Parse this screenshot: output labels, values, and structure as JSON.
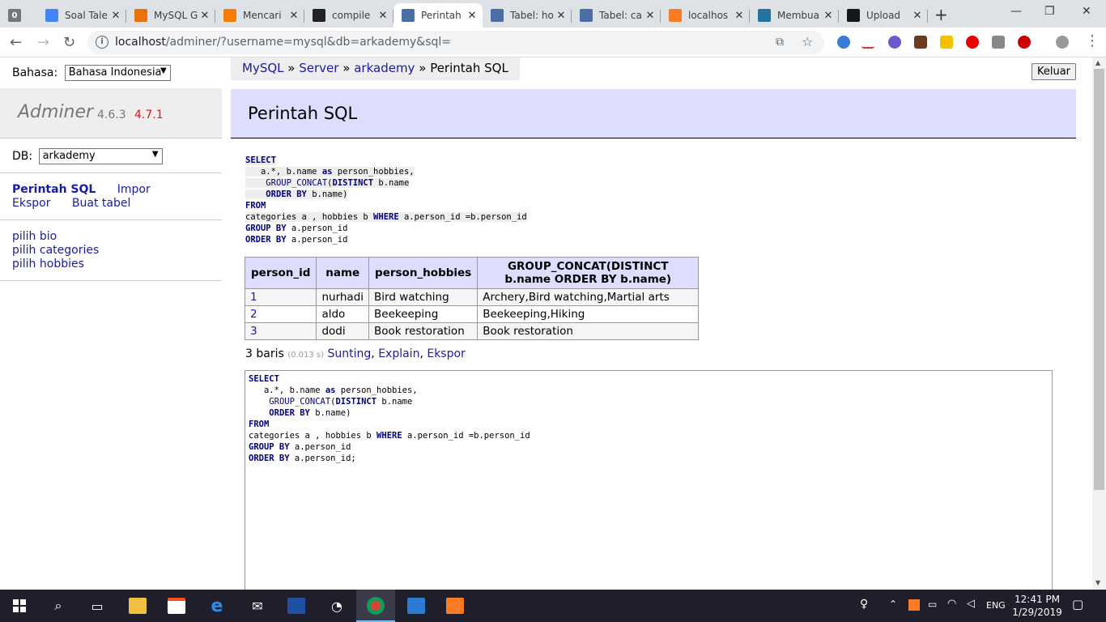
{
  "browser": {
    "tabs": [
      {
        "title": "Soal Tale",
        "favicon": "docs-icon",
        "color": "#4285f4"
      },
      {
        "title": "MySQL G",
        "favicon": "mysql-icon",
        "color": "#e8710a"
      },
      {
        "title": "Mencari",
        "favicon": "blogger-icon",
        "color": "#f57d00"
      },
      {
        "title": "compile",
        "favicon": "t-icon",
        "color": "#222222"
      },
      {
        "title": "Perintah",
        "favicon": "adminer-icon",
        "color": "#4a6fa5",
        "active": true
      },
      {
        "title": "Tabel: ho",
        "favicon": "adminer-icon",
        "color": "#4a6fa5"
      },
      {
        "title": "Tabel: ca",
        "favicon": "adminer-icon",
        "color": "#4a6fa5"
      },
      {
        "title": "localhos",
        "favicon": "xampp-icon",
        "color": "#fb7a24"
      },
      {
        "title": "Membua",
        "favicon": "wordpress-icon",
        "color": "#21759b"
      },
      {
        "title": "Upload",
        "favicon": "github-icon",
        "color": "#181717"
      }
    ],
    "url_host": "localhost",
    "url_rest": "/adminer/?username=mysql&db=arkademy&sql="
  },
  "sidebar": {
    "lang_label": "Bahasa:",
    "lang_value": "Bahasa Indonesia",
    "app_name": "Adminer",
    "version": "4.6.3",
    "new_version": "4.7.1",
    "db_label": "DB:",
    "db_value": "arkademy",
    "links": {
      "sql": "Perintah SQL",
      "import": "Impor",
      "export": "Ekspor",
      "create": "Buat tabel"
    },
    "tables": [
      "pilih bio",
      "pilih categories",
      "pilih hobbies"
    ]
  },
  "breadcrumb": {
    "items": [
      "MySQL",
      "Server",
      "arkademy"
    ],
    "separator": "»",
    "current": "Perintah SQL"
  },
  "logout_label": "Keluar",
  "page_title": "Perintah SQL",
  "result": {
    "columns": [
      "person_id",
      "name",
      "person_hobbies",
      "GROUP_CONCAT(DISTINCT b.name ORDER BY b.name)"
    ],
    "rows": [
      [
        "1",
        "nurhadi",
        "Bird watching",
        "Archery,Bird watching,Martial arts"
      ],
      [
        "2",
        "aldo",
        "Beekeeping",
        "Beekeeping,Hiking"
      ],
      [
        "3",
        "dodi",
        "Book restoration",
        "Book restoration"
      ]
    ]
  },
  "rowcount": {
    "count": "3 baris",
    "time": "(0.013 s)",
    "edit": "Sunting",
    "explain": "Explain",
    "export": "Ekspor"
  },
  "taskbar": {
    "lang": "ENG",
    "time": "12:41 PM",
    "date": "1/29/2019"
  }
}
